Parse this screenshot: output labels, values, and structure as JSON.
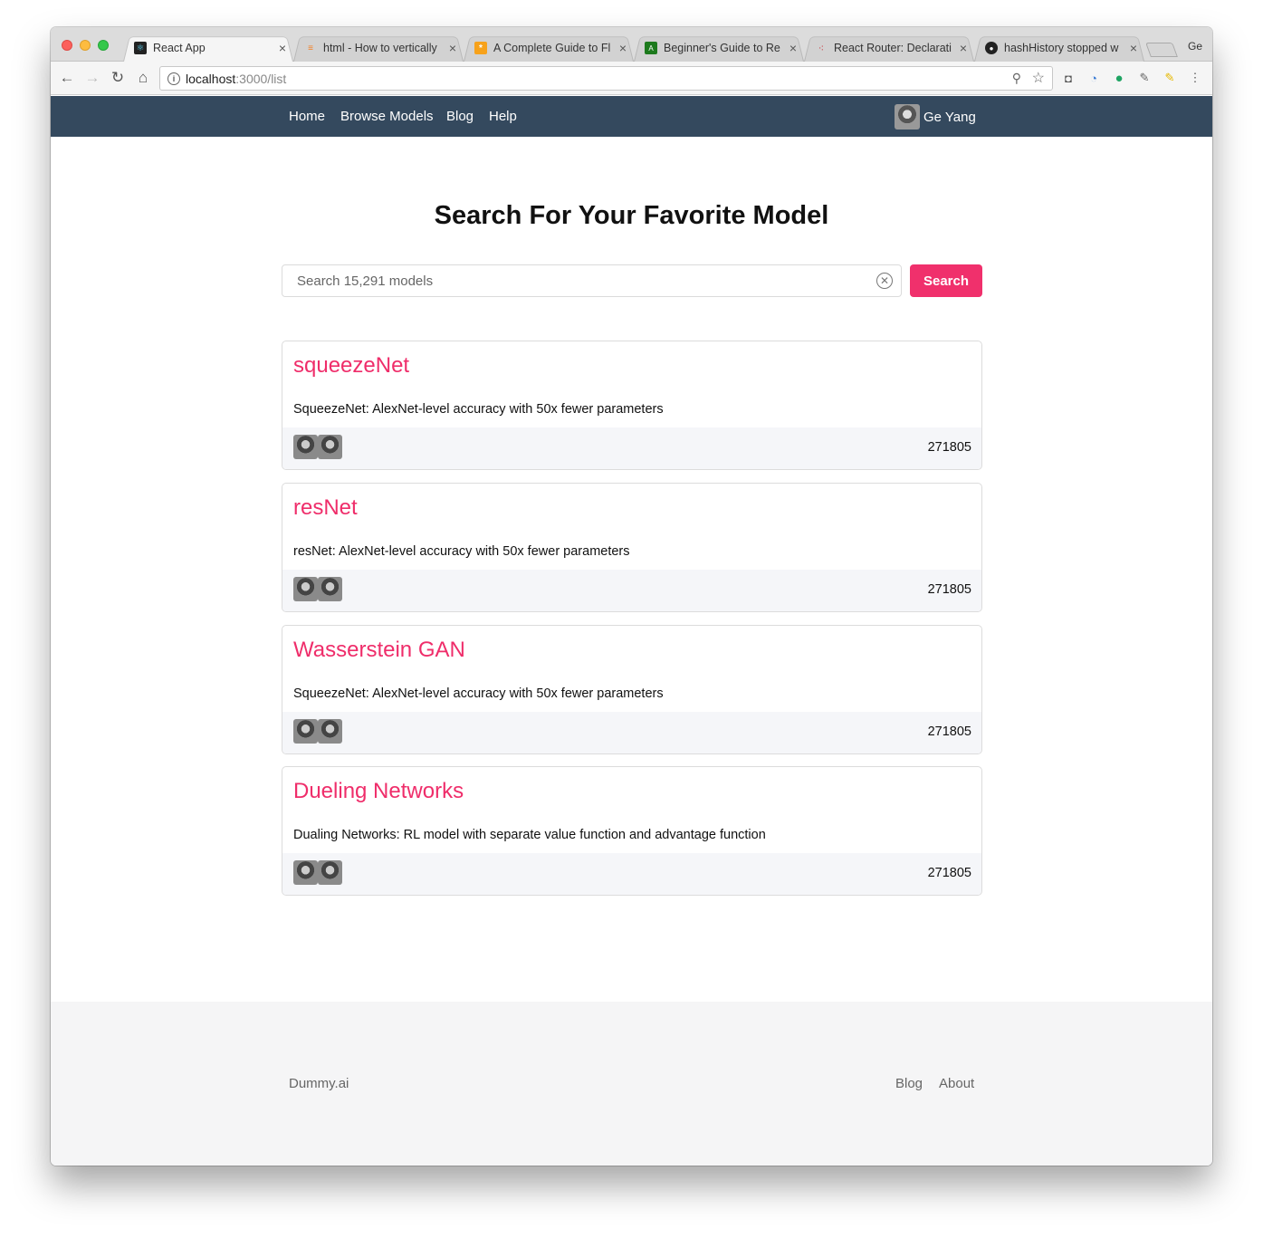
{
  "browser": {
    "tabs": [
      {
        "label": "React App",
        "favicon": "react-logo-icon",
        "active": true
      },
      {
        "label": "html - How to vertically",
        "favicon": "stackoverflow-icon"
      },
      {
        "label": "A Complete Guide to Fl",
        "favicon": "css-tricks-icon"
      },
      {
        "label": "Beginner's Guide to Re",
        "favicon": "codepen-icon"
      },
      {
        "label": "React Router: Declarati",
        "favicon": "react-router-icon"
      },
      {
        "label": "hashHistory stopped w",
        "favicon": "github-icon"
      }
    ],
    "close_glyph": "×",
    "profile_label": "Ge",
    "url_host": "localhost",
    "url_path": ":3000/list"
  },
  "nav": {
    "links": [
      "Home",
      "Browse Models",
      "Blog",
      "Help"
    ],
    "user_name": "Ge Yang",
    "background": "#34495e"
  },
  "main": {
    "title": "Search For Your Favorite Model",
    "search_placeholder": "Search 15,291 models",
    "search_button": "Search",
    "accent": "#f0306c"
  },
  "models": [
    {
      "name": "squeezeNet",
      "description": "SqueezeNet: AlexNet-level accuracy with 50x fewer parameters",
      "count": "271805"
    },
    {
      "name": "resNet",
      "description": "resNet: AlexNet-level accuracy with 50x fewer parameters",
      "count": "271805"
    },
    {
      "name": "Wasserstein GAN",
      "description": "SqueezeNet: AlexNet-level accuracy with 50x fewer parameters",
      "count": "271805"
    },
    {
      "name": "Dueling Networks",
      "description": "Dualing Networks: RL model with separate value function and advantage function",
      "count": "271805"
    }
  ],
  "footer": {
    "brand": "Dummy.ai",
    "links": [
      "Blog",
      "About"
    ]
  }
}
